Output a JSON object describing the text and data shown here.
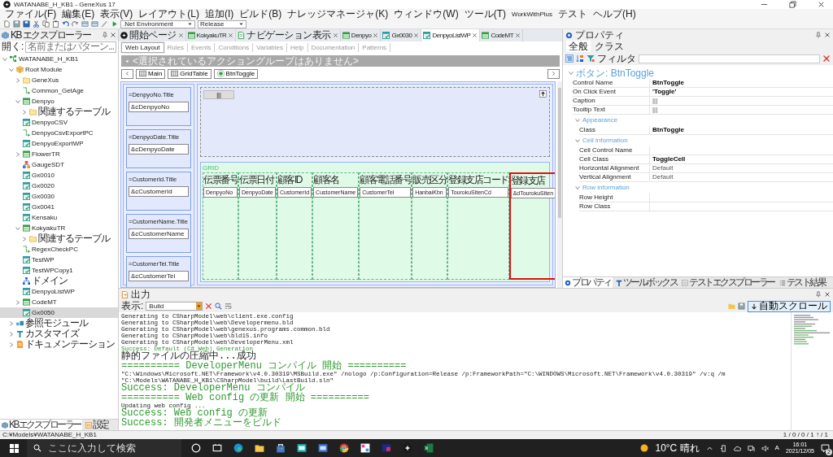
{
  "window": {
    "title": "WATANABE_H_KB1 - GeneXus 17"
  },
  "menu": [
    "ファイル(F)",
    "編集(E)",
    "表示(V)",
    "レイアウト(L)",
    "追加(I)",
    "ビルド(B)",
    "ナレッジマネージャ(K)",
    "ウィンドウ(W)",
    "ツール(T)",
    "WorkWithPlus",
    "テスト",
    "ヘルプ(H)"
  ],
  "toolbar": {
    "environment": ".Net Environment",
    "configuration": "Release"
  },
  "kb_explorer": {
    "title": "KB エクスプローラー",
    "search_label": "開く:",
    "search_placeholder": "名前またはパターン...",
    "tree": [
      {
        "label": "WATANABE_H_KB1",
        "kind": "kb",
        "expanded": true,
        "selected": false,
        "children": [
          {
            "label": "Root Module",
            "kind": "module",
            "expanded": true,
            "selected": false,
            "children": [
              {
                "label": "GeneXus",
                "kind": "folder",
                "expanded": false,
                "selected": false
              },
              {
                "label": "Common_GetAge",
                "kind": "procedure",
                "selected": false
              },
              {
                "label": "Denpyo",
                "kind": "transaction",
                "expanded": true,
                "selected": false,
                "children": [
                  {
                    "label": "関連するテーブル",
                    "kind": "folder",
                    "expanded": false,
                    "selected": false
                  }
                ]
              },
              {
                "label": "DenpyoCSV",
                "kind": "webpanel",
                "selected": false
              },
              {
                "label": "DenpyoCsvExportPC",
                "kind": "procedure",
                "selected": false
              },
              {
                "label": "DenpyoExportWP",
                "kind": "webpanel",
                "selected": false
              },
              {
                "label": "FlowerTR",
                "kind": "transaction",
                "expanded": false,
                "selected": false
              },
              {
                "label": "GaugeSDT",
                "kind": "sdt",
                "selected": false
              },
              {
                "label": "Gx0010",
                "kind": "webpanel",
                "selected": false
              },
              {
                "label": "Gx0020",
                "kind": "webpanel",
                "selected": false
              },
              {
                "label": "Gx0030",
                "kind": "webpanel",
                "selected": false
              },
              {
                "label": "Gx0041",
                "kind": "webpanel",
                "selected": false
              },
              {
                "label": "Kensaku",
                "kind": "webpanel",
                "selected": false
              },
              {
                "label": "KokyakuTR",
                "kind": "transaction",
                "expanded": true,
                "selected": false,
                "children": [
                  {
                    "label": "関連するテーブル",
                    "kind": "folder",
                    "expanded": false,
                    "selected": false
                  }
                ]
              },
              {
                "label": "RegexCheckPC",
                "kind": "procedure",
                "selected": false
              },
              {
                "label": "TestWP",
                "kind": "webpanel",
                "selected": false
              },
              {
                "label": "TestWPCopy1",
                "kind": "webpanel",
                "selected": false
              },
              {
                "label": "ドメイン",
                "kind": "domain",
                "selected": false
              },
              {
                "label": "DenpyoListWP",
                "kind": "webpanel",
                "selected": false
              },
              {
                "label": "CodeMT",
                "kind": "transaction",
                "expanded": false,
                "selected": false
              },
              {
                "label": "Gx0050",
                "kind": "webpanel",
                "selected": true
              }
            ]
          },
          {
            "label": "参照モジュール",
            "kind": "refmodule",
            "expanded": false,
            "selected": false
          },
          {
            "label": "カスタマイズ",
            "kind": "customize",
            "expanded": false,
            "selected": false
          },
          {
            "label": "ドキュメンテーション",
            "kind": "documentation",
            "expanded": false,
            "selected": false
          }
        ]
      }
    ],
    "bottom_tabs": [
      {
        "label": "KB エクスプローラー",
        "kind": "explorer",
        "selected": true
      },
      {
        "label": "設定",
        "kind": "settings",
        "selected": false
      }
    ]
  },
  "editor": {
    "tabs": [
      {
        "label": "開始ページ",
        "kind": "start",
        "selected": false
      },
      {
        "label": "KokyakuTR",
        "kind": "transaction",
        "selected": false
      },
      {
        "label": "ナビゲーション表示",
        "kind": "navigation",
        "selected": false
      },
      {
        "label": "Denpyo",
        "kind": "transaction",
        "selected": false
      },
      {
        "label": "Gx0030",
        "kind": "webpanel",
        "selected": false
      },
      {
        "label": "DenpyoListWP",
        "kind": "webpanel",
        "selected": true
      },
      {
        "label": "CodeMT",
        "kind": "transaction",
        "selected": false
      }
    ],
    "subtabs": [
      {
        "label": "Web Layout",
        "selected": true
      },
      {
        "label": "Rules",
        "selected": false
      },
      {
        "label": "Events",
        "selected": false
      },
      {
        "label": "Conditions",
        "selected": false
      },
      {
        "label": "Variables",
        "selected": false
      },
      {
        "label": "Help",
        "selected": false
      },
      {
        "label": "Documentation",
        "selected": false
      },
      {
        "label": "Patterns",
        "selected": false
      }
    ],
    "action_bar": "<選択されているアクショングループはありません>",
    "breadcrumb": [
      {
        "label": "Main",
        "kind": "table"
      },
      {
        "label": "GridTable",
        "kind": "table"
      },
      {
        "label": "BtnToggle",
        "kind": "button"
      }
    ],
    "form_fields": [
      {
        "title": "=DenpyoNo.Title",
        "value": "&cDenpyoNo"
      },
      {
        "title": "=DenpyoDate.Title",
        "value": "&cDenpyoDate"
      },
      {
        "title": "=CustomerId.Title",
        "value": "&cCustomerId"
      },
      {
        "title": "=CustomerName.Title",
        "value": "&cCustomerName"
      },
      {
        "title": "=CustomerTel.Title",
        "value": "&cCustomerTel"
      }
    ],
    "toggle_button": "|||",
    "grid": {
      "label": "GRID",
      "columns": [
        {
          "header": "伝票番号",
          "field": "DenpyoNo",
          "selected": false
        },
        {
          "header": "伝票日付",
          "field": "DenpyoDate",
          "selected": false
        },
        {
          "header": "顧客ID",
          "field": "CustomerId",
          "selected": false
        },
        {
          "header": "顧客名",
          "field": "CustomerName",
          "selected": false
        },
        {
          "header": "顧客電話番号",
          "field": "CustomerTel",
          "selected": false
        },
        {
          "header": "販売区分",
          "field": "HanbaiKbn",
          "selected": false
        },
        {
          "header": "登録支店コード",
          "field": "TourokuSitenCd",
          "selected": false
        },
        {
          "header": "登録支店",
          "field": "&dTourokuSiten",
          "selected": true
        }
      ]
    }
  },
  "properties": {
    "title": "プロパティ",
    "tabs": [
      {
        "label": "全般",
        "selected": true
      },
      {
        "label": "クラス",
        "selected": false
      }
    ],
    "filter_label": "フィルタ",
    "groups": [
      {
        "title": "ボタン: BtnToggle",
        "expanded": true,
        "rows": [
          {
            "name": "Control Name",
            "value": "BtnToggle",
            "modified": true
          },
          {
            "name": "On Click Event",
            "value": "'Toggle'",
            "modified": true
          },
          {
            "name": "Caption",
            "value": "|||",
            "modified": false
          },
          {
            "name": "Tooltip Text",
            "value": "|||",
            "modified": false
          }
        ],
        "children": [
          {
            "title": "Appearance",
            "expanded": true,
            "rows": [
              {
                "name": "Class",
                "value": "BtnToggle",
                "modified": true
              }
            ]
          },
          {
            "title": "Cell information",
            "expanded": true,
            "rows": [
              {
                "name": "Cell Control Name"
              },
              {
                "name": "Cell Class",
                "value": "ToggleCell",
                "modified": true
              },
              {
                "name": "Horizontal Alignment",
                "value": "Default",
                "modified": false
              },
              {
                "name": "Vertical Alignment",
                "value": "Default",
                "modified": false
              }
            ]
          },
          {
            "title": "Row information",
            "expanded": true,
            "rows": [
              {
                "name": "Row Height"
              },
              {
                "name": "Row Class"
              }
            ]
          }
        ]
      }
    ],
    "bottom_tabs": [
      {
        "label": "プロパティ",
        "kind": "properties",
        "selected": true
      },
      {
        "label": "ツールボックス",
        "kind": "toolbox",
        "selected": false
      },
      {
        "label": "テストエクスプローラー",
        "kind": "testexplorer",
        "selected": false
      },
      {
        "label": "テスト結果",
        "kind": "testresults",
        "selected": false
      }
    ]
  },
  "output": {
    "title": "出力",
    "show_label": "表示:",
    "source": "Build",
    "autoscroll": "自動スクロール",
    "lines": [
      {
        "text": "Generating to CSharpModel\\web\\client.exe.config",
        "kind": "info"
      },
      {
        "text": "Generating to CSharpModel\\web\\Developermenu.bld",
        "kind": "info"
      },
      {
        "text": "Generating to CSharpModel\\web\\genexus.programs.common.bld",
        "kind": "info"
      },
      {
        "text": "Generating to CSharpModel\\web\\bld15.info",
        "kind": "info"
      },
      {
        "text": "Generating to CSharpModel\\web\\DeveloperMenu.xml",
        "kind": "info"
      },
      {
        "text": "Success: Default (C# Web) Generation",
        "kind": "success"
      },
      {
        "text": "静的ファイルの圧縮中...成功",
        "kind": "info"
      },
      {
        "text": "========== DeveloperMenu コンパイル 開始 ==========",
        "kind": "success"
      },
      {
        "text": "\"C:\\Windows\\Microsoft.NET\\Framework\\v4.0.30319\\MSBuild.exe\" /nologo /p:Configuration=Release /p:FrameworkPath=\"C:\\WINDOWS\\Microsoft.NET\\Framework\\v4.0.30319\" /v:q /m  \"C:\\Models\\WATANABE_H_KB1\\CSharpModel\\build\\LastBuild.sln\"",
        "kind": "info"
      },
      {
        "text": "Success: DeveloperMenu コンパイル",
        "kind": "success"
      },
      {
        "text": "========== Web config の更新 開始 ==========",
        "kind": "success"
      },
      {
        "text": "Updating web config ...",
        "kind": "info"
      },
      {
        "text": "Success: Web config の更新",
        "kind": "success"
      },
      {
        "text": "Success: 開発者メニューをビルド",
        "kind": "success"
      }
    ]
  },
  "status_bar": {
    "path": "C:¥Models¥WATANABE_H_KB1",
    "counts": "1 / 0 / 0 / 1 ↑ / 1"
  },
  "taskbar": {
    "search_placeholder": "ここに入力して検索",
    "weather": "10°C 晴れ",
    "ime": "A",
    "time": "16:01",
    "date": "2021/12/05",
    "notifications": "2"
  }
}
